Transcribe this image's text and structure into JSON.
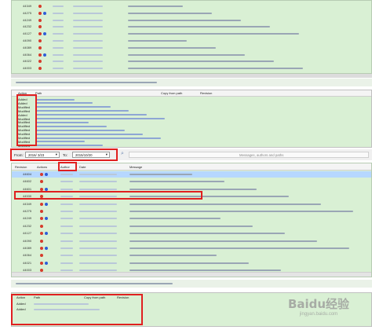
{
  "top_log": {
    "revisions": [
      "44349",
      "44275",
      "44249",
      "44232",
      "44127",
      "44090",
      "44089",
      "44064",
      "44022",
      "44003"
    ]
  },
  "changed_paths_1": {
    "headers": [
      "Action",
      "Path",
      "Copy from path",
      "Revision"
    ],
    "actions": [
      "Added",
      "Added",
      "Modified",
      "Modified",
      "Added",
      "Modified",
      "Modified",
      "Modified",
      "Modified",
      "Modified",
      "Modified",
      "Modified",
      "Modified"
    ]
  },
  "filter": {
    "from_label": "From:",
    "from_value": "2016/ 3/23",
    "to_label": "To:",
    "to_value": "2015/10/20",
    "search_placeholder": "Messages, authors and paths"
  },
  "log_table": {
    "headers": [
      "Revision",
      "Actions",
      "Author",
      "Date",
      "Message"
    ],
    "revisions": [
      "44604",
      "44602",
      "44601",
      "44530",
      "44349",
      "44275",
      "44249",
      "44232",
      "44127",
      "44090",
      "44089",
      "44064",
      "44021",
      "44003"
    ]
  },
  "changed_paths_2": {
    "headers": [
      "Action",
      "Path",
      "Copy from path",
      "Revision"
    ],
    "actions": [
      "Added",
      "Added"
    ]
  },
  "watermark": {
    "text": "Baidu经验",
    "url": "jingyan.baidu.com"
  },
  "colors": {
    "green_panel": "#d9f0d4",
    "highlight": "#e02020",
    "selected_row": "#b6d7ff"
  }
}
